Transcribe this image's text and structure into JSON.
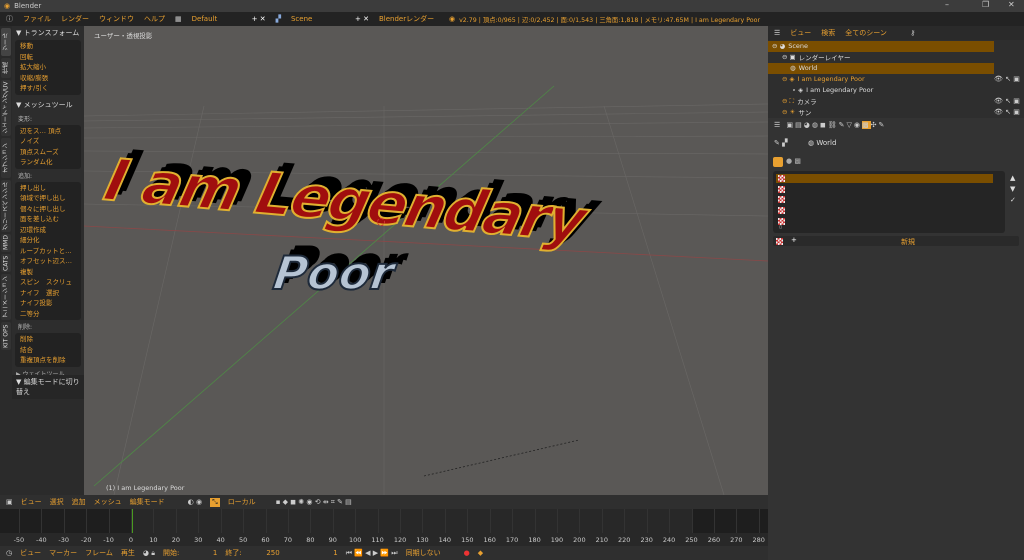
{
  "window": {
    "title": "Blender",
    "min": "–",
    "max": "❐",
    "close": "✕"
  },
  "menubar": {
    "items": [
      "ファイル",
      "レンダー",
      "ウィンドウ",
      "ヘルプ"
    ],
    "layout": "Default",
    "scene": "Scene",
    "engine": "Blenderレンダー",
    "stats": "v2.79 | 頂点:0/965 | 辺:0/2,452 | 面:0/1,543 | 三角面:1,818 | メモリ:47.65M | I am Legendary Poor"
  },
  "tabs": [
    "ツール",
    "作成",
    "シェーディング/UV",
    "オプション",
    "グリースペンシル",
    "MMD",
    "CATS",
    "アニメーション",
    "KIT OPS"
  ],
  "toolpanel": {
    "transform_title": "▼ トランスフォーム",
    "transform": [
      "移動",
      "回転",
      "拡大縮小",
      "収縮/膨張",
      "押す/引く"
    ],
    "meshtools_title": "▼ メッシュツール",
    "deform_label": "変形:",
    "deform": [
      "辺をス… 頂点",
      "ノイズ",
      "頂点スムーズ",
      "ランダム化"
    ],
    "add_label": "追加:",
    "add": [
      "押し出し",
      "領域で押し出し",
      "個々に押し出し",
      "面を差し込む",
      "辺環作成",
      "細分化",
      "ループカットと…",
      "オフセット辺ス…",
      "複製",
      "スピン　スクリュ",
      "ナイフ　選択",
      "ナイフ投影",
      "二等分"
    ],
    "delete_label": "削除:",
    "delete": [
      "削除",
      "結合",
      "重複頂点を削除"
    ],
    "weight_title": "▶ ウェイトツール",
    "editmode": "▼ 編集モードに切り替え"
  },
  "viewport": {
    "view_label": "ユーザー・透視投影",
    "object_label": "(1) I am Legendary Poor",
    "scene_text_1": "I am Legendary",
    "scene_text_2": "Poor"
  },
  "viewport_header": {
    "items": [
      "ビュー",
      "選択",
      "追加",
      "メッシュ"
    ],
    "mode": "編集モード",
    "orientation": "ローカル"
  },
  "timeline": {
    "ticks": [
      -50,
      -40,
      -30,
      -20,
      -10,
      0,
      10,
      20,
      30,
      40,
      50,
      60,
      70,
      80,
      90,
      100,
      110,
      120,
      130,
      140,
      150,
      160,
      170,
      180,
      190,
      200,
      210,
      220,
      230,
      240,
      250,
      260,
      270,
      280
    ],
    "current_frame": 0,
    "start": 1,
    "end": 250
  },
  "timeline_header": {
    "items": [
      "ビュー",
      "マーカー",
      "フレーム",
      "再生"
    ],
    "start_label": "開始:",
    "start": "1",
    "end_label": "終了:",
    "end": "250",
    "current": "1",
    "sync": "同期しない"
  },
  "outliner": {
    "header": [
      "ビュー",
      "検索",
      "全てのシーン"
    ],
    "rows": [
      "Scene",
      "レンダーレイヤー",
      "World",
      "I am Legendary Poor",
      "I am Legendary Poor",
      "カメラ",
      "サン"
    ]
  },
  "properties": {
    "context": "World",
    "new_button": "新規",
    "list_count": "0"
  },
  "colors": {
    "accent": "#e8a030",
    "selected_row": "#7a4e00"
  }
}
